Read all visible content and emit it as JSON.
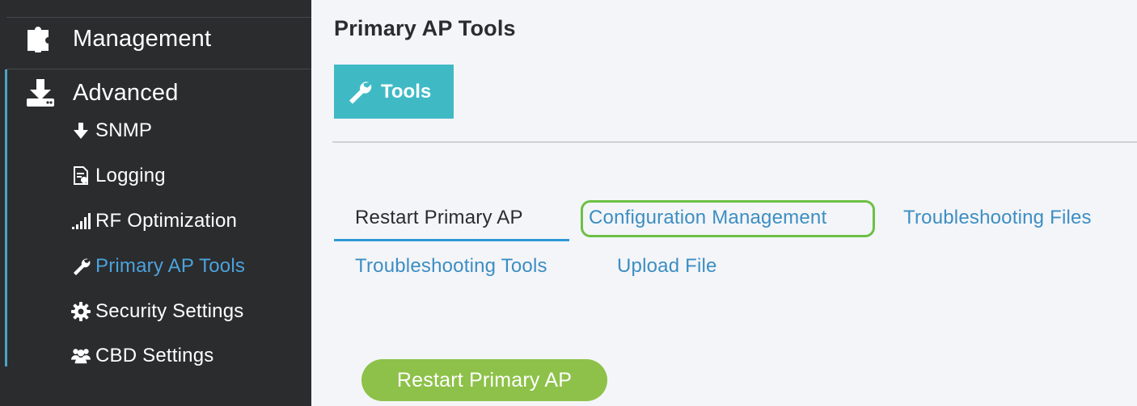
{
  "sidebar": {
    "sections": {
      "management": {
        "label": "Management",
        "icon": "puzzle-icon"
      },
      "advanced": {
        "label": "Advanced",
        "icon": "download-icon"
      }
    },
    "items": [
      {
        "label": "SNMP",
        "icon": "arrow-down-icon",
        "active": false
      },
      {
        "label": "Logging",
        "icon": "log-file-icon",
        "active": false
      },
      {
        "label": "RF Optimization",
        "icon": "signal-bars-icon",
        "active": false
      },
      {
        "label": "Primary AP Tools",
        "icon": "wrench-icon",
        "active": true
      },
      {
        "label": "Security Settings",
        "icon": "gear-icon",
        "active": false
      },
      {
        "label": "CBD Settings",
        "icon": "users-icon",
        "active": false
      }
    ]
  },
  "main": {
    "title": "Primary AP Tools",
    "tools_button": {
      "label": "Tools",
      "icon": "wrench-icon"
    },
    "tabs": [
      {
        "label": "Restart Primary AP",
        "active": true
      },
      {
        "label": "Configuration Management",
        "active": false,
        "highlighted": true
      },
      {
        "label": "Troubleshooting Files",
        "active": false
      },
      {
        "label": "Troubleshooting Tools",
        "active": false
      },
      {
        "label": "Upload File",
        "active": false
      }
    ],
    "restart_button": {
      "label": "Restart Primary AP"
    }
  },
  "colors": {
    "sidebar_bg": "#2b2c2e",
    "accent_blue": "#4ba3dd",
    "tools_teal": "#3fbac5",
    "highlight_green": "#6cc045",
    "restart_green": "#8dc149"
  }
}
